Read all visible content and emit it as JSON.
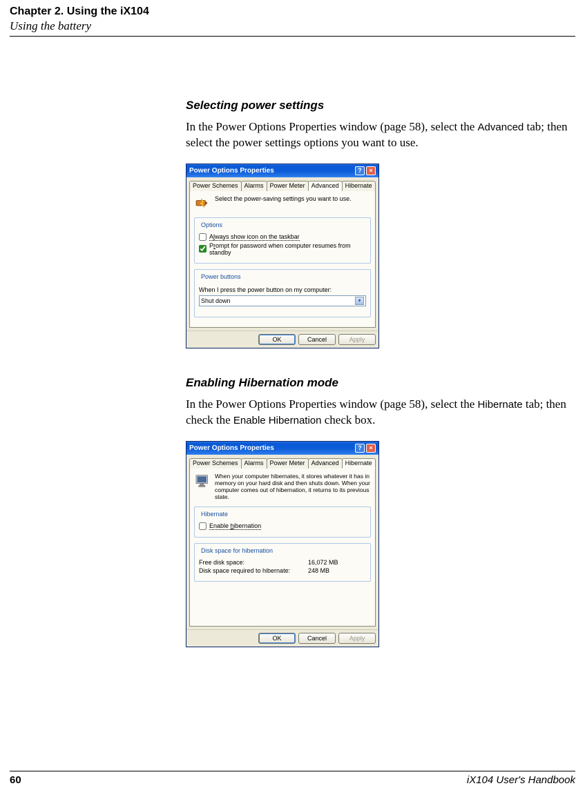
{
  "header": {
    "chapter": "Chapter 2. Using the iX104",
    "section": "Using the battery"
  },
  "sect1": {
    "heading": "Selecting power settings",
    "para_a": "In the Power Options Properties window (page 58), select the ",
    "para_b": "Advanced",
    "para_c": " tab; then select the power settings options you want to use."
  },
  "sect2": {
    "heading": "Enabling Hibernation mode",
    "para_a": "In the Power Options Properties window (page 58), select the ",
    "para_b": "Hibernate",
    "para_c": " tab; then check the ",
    "para_d": "Enable Hibernation",
    "para_e": " check box."
  },
  "dialog": {
    "title": "Power Options Properties",
    "tabs": [
      "Power Schemes",
      "Alarms",
      "Power Meter",
      "Advanced",
      "Hibernate"
    ],
    "buttons": {
      "ok": "OK",
      "cancel": "Cancel",
      "apply": "Apply"
    },
    "advanced": {
      "desc": "Select the power-saving settings you want to use.",
      "grp_options": "Options",
      "opt1_pre": "A",
      "opt1_acc": "l",
      "opt1_post": "ways show icon on the taskbar",
      "opt2_pre": "P",
      "opt2_acc": "r",
      "opt2_post": "ompt for password when computer resumes from standby",
      "grp_power": "Power buttons",
      "pb_label": "When I press the power button on my computer:",
      "pb_value": "Shut down"
    },
    "hibernate": {
      "desc": "When your computer hibernates, it stores whatever it has in memory on your hard disk and then shuts down. When your computer comes out of hibernation, it returns to its previous state.",
      "grp_hib": "Hibernate",
      "enable_pre": "Enable ",
      "enable_acc": "h",
      "enable_post": "ibernation",
      "grp_disk": "Disk space for hibernation",
      "free_label": "Free disk space:",
      "free_value": "16,072 MB",
      "req_label": "Disk space required to hibernate:",
      "req_value": "248 MB"
    }
  },
  "footer": {
    "page": "60",
    "book": "iX104 User's Handbook"
  }
}
